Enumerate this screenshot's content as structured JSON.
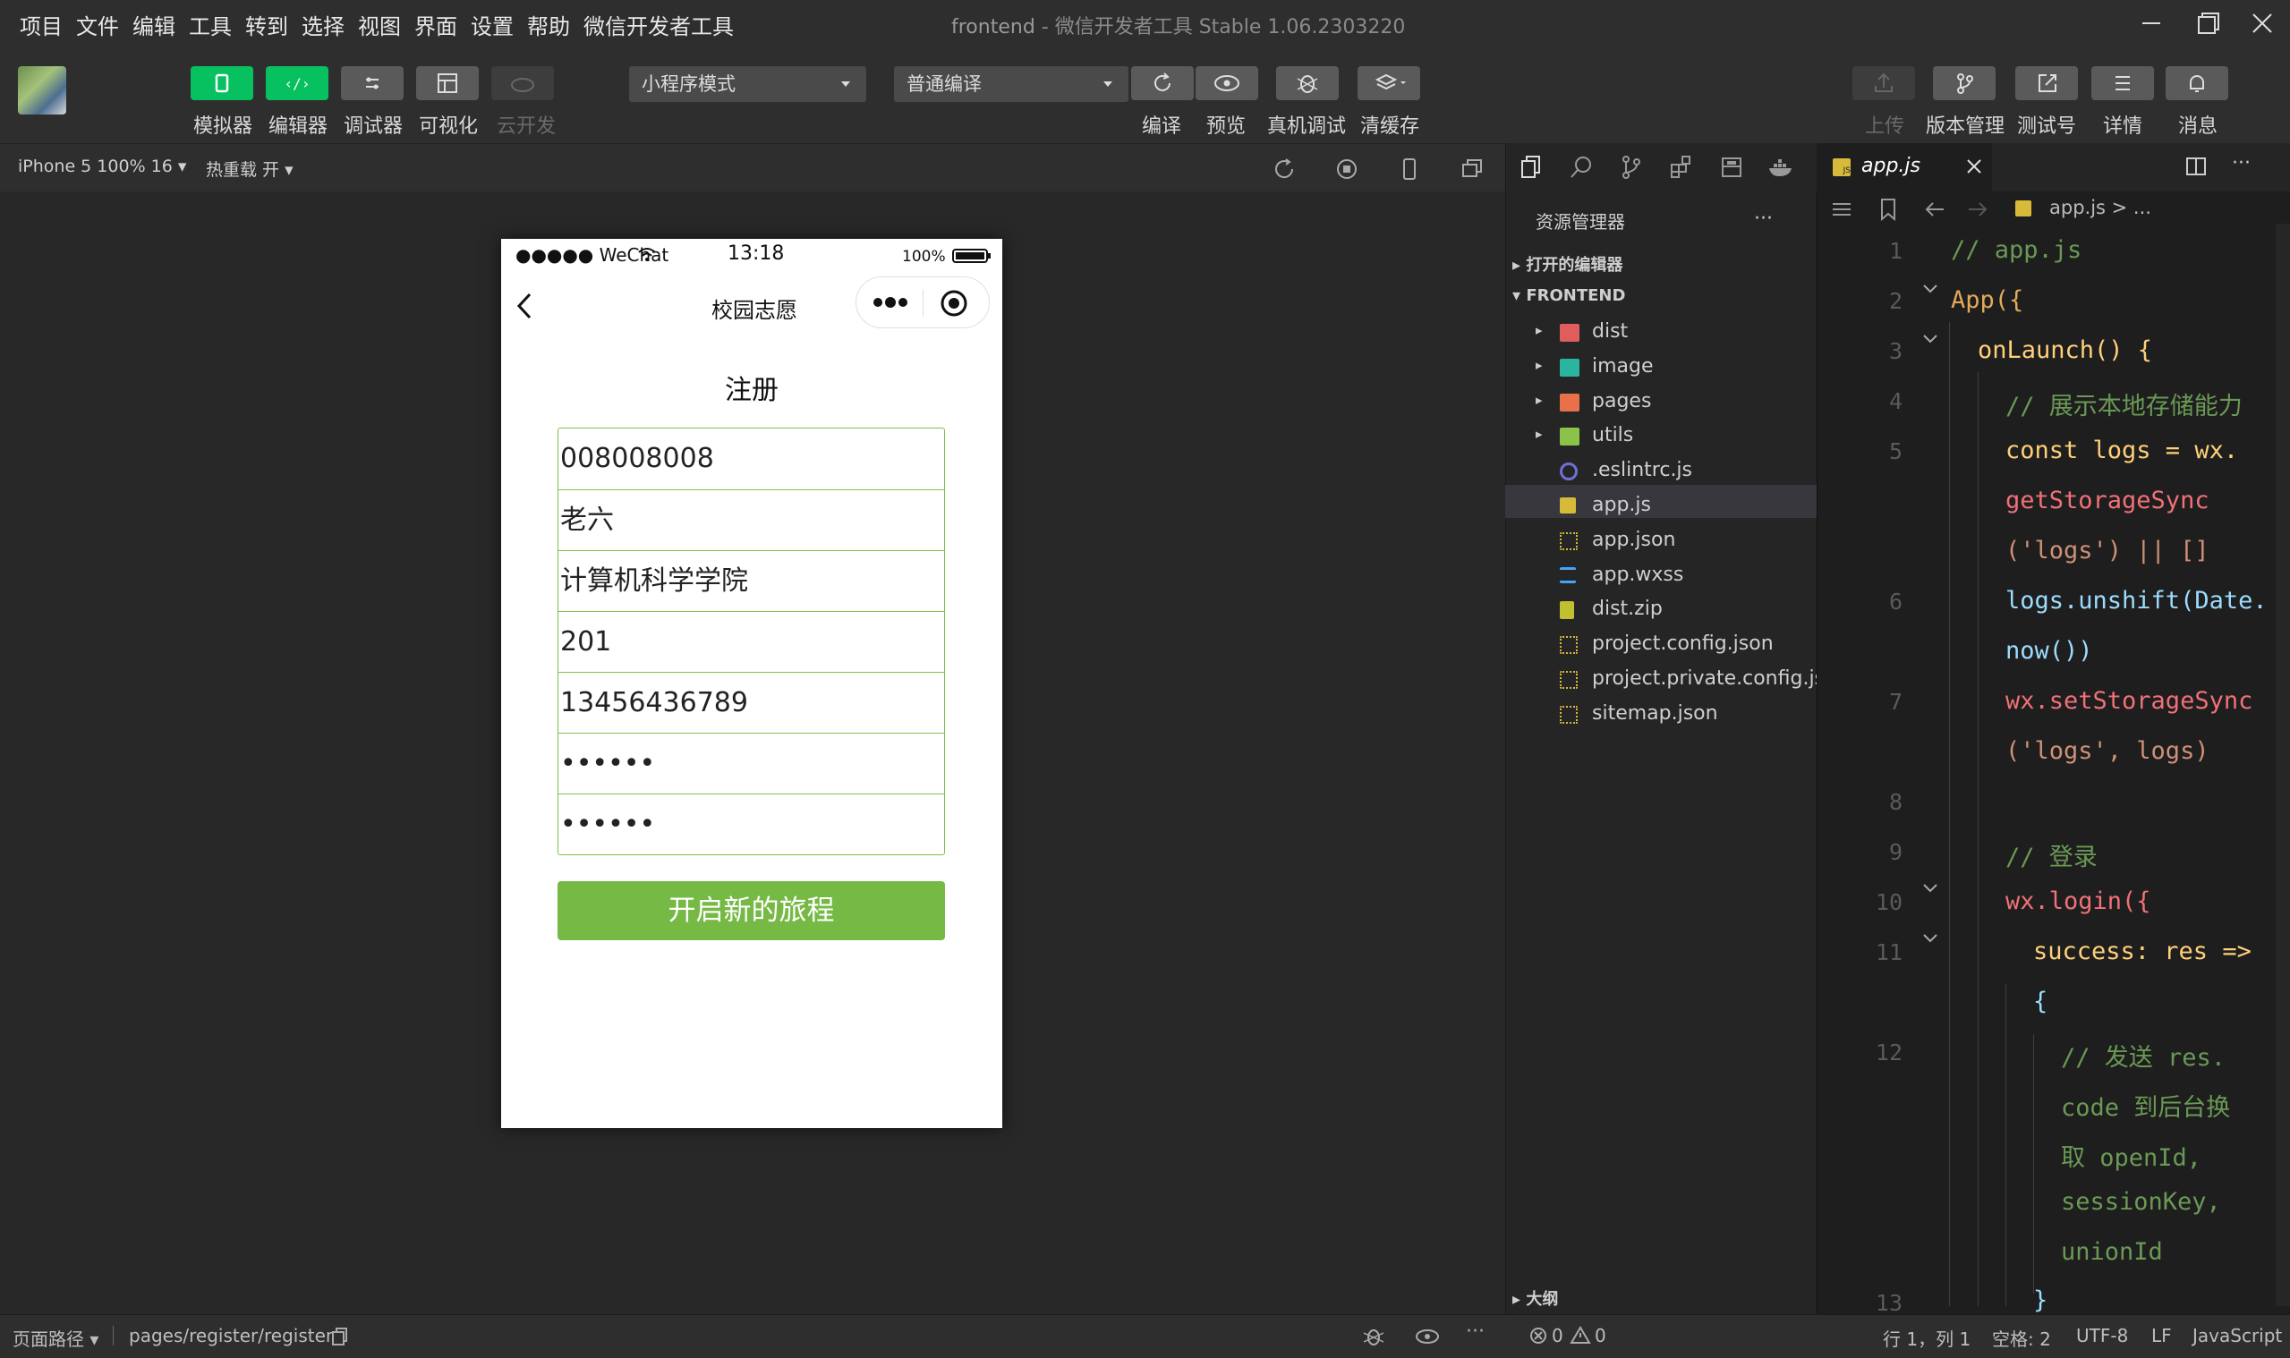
{
  "menubar": {
    "items": [
      "项目",
      "文件",
      "编辑",
      "工具",
      "转到",
      "选择",
      "视图",
      "界面",
      "设置",
      "帮助",
      "微信开发者工具"
    ],
    "title": "frontend",
    "subtitle": " - 微信开发者工具 Stable 1.06.2303220"
  },
  "toolbar": {
    "simulator": "模拟器",
    "editor": "编辑器",
    "debugger": "调试器",
    "visual": "可视化",
    "cloud": "云开发",
    "mode": "小程序模式",
    "compile_mode": "普通编译",
    "compile": "编译",
    "preview": "预览",
    "real_debug": "真机调试",
    "clear_cache": "清缓存",
    "upload": "上传",
    "version": "版本管理",
    "test_account": "测试号",
    "details": "详情",
    "messages": "消息"
  },
  "subbar": {
    "device": "iPhone 5 100% 16",
    "hot_reload": "热重载 开"
  },
  "phone": {
    "signal": "●●●●● WeChat",
    "time": "13:18",
    "battery": "100%",
    "nav_title": "校园志愿",
    "page_title": "注册",
    "fields": [
      "008008008",
      "老六",
      "计算机科学学院",
      "201",
      "13456436789",
      "••••••",
      "••••••"
    ],
    "submit": "开启新的旅程"
  },
  "explorer": {
    "title": "资源管理器",
    "open_editors": "打开的编辑器",
    "project": "FRONTEND",
    "outline": "大纲",
    "files": [
      {
        "name": "dist",
        "type": "folder",
        "color": "#e05d5d"
      },
      {
        "name": "image",
        "type": "folder",
        "color": "#2bb5a0"
      },
      {
        "name": "pages",
        "type": "folder",
        "color": "#e8714a"
      },
      {
        "name": "utils",
        "type": "folder",
        "color": "#8bc34a"
      },
      {
        "name": ".eslintrc.js",
        "type": "eslint",
        "color": "#6f6fd8"
      },
      {
        "name": "app.js",
        "type": "js",
        "color": "#d7ba3a"
      },
      {
        "name": "app.json",
        "type": "json",
        "color": "#d7ba3a"
      },
      {
        "name": "app.wxss",
        "type": "css",
        "color": "#42a5f5"
      },
      {
        "name": "dist.zip",
        "type": "zip",
        "color": "#c0c030"
      },
      {
        "name": "project.config.json",
        "type": "json",
        "color": "#d7ba3a"
      },
      {
        "name": "project.private.config.js...",
        "type": "json",
        "color": "#d7ba3a"
      },
      {
        "name": "sitemap.json",
        "type": "json",
        "color": "#d7ba3a"
      }
    ]
  },
  "editor": {
    "tab": "app.js",
    "breadcrumb": "app.js > ...",
    "line_numbers": [
      "1",
      "2",
      "3",
      "4",
      "5",
      "6",
      "7",
      "8",
      "9",
      "10",
      "11",
      "12",
      "13"
    ],
    "lines": [
      "// app.js",
      "App({",
      "onLaunch() {",
      "// 展示本地存储能力",
      "const logs = wx.",
      "getStorageSync",
      "('logs') || []",
      "logs.unshift(Date.",
      "now())",
      "wx.setStorageSync",
      "('logs', logs)",
      "// 登录",
      "wx.login({",
      "success: res =>",
      "{",
      "// 发送 res.",
      "code 到后台换",
      "取 openId,",
      "sessionKey,",
      "unionId",
      "}"
    ]
  },
  "statusbar": {
    "page_path_label": "页面路径",
    "page_path": "pages/register/register",
    "errors": "0",
    "warnings": "0",
    "position": "行 1，列 1",
    "spaces": "空格: 2",
    "encoding": "UTF-8",
    "eol": "LF",
    "language": "JavaScript"
  }
}
